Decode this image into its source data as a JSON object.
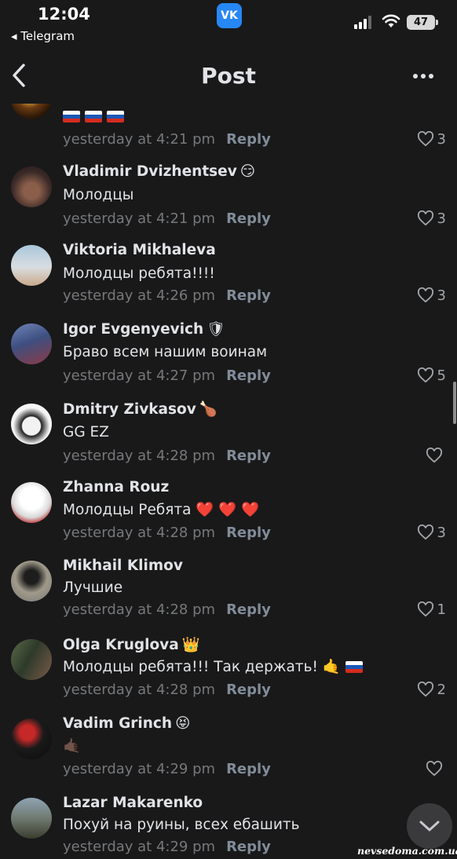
{
  "status_bar": {
    "time": "12:04",
    "back_app": "◂ Telegram",
    "app_icon_label": "VK",
    "battery": "47",
    "icons": [
      "signal-icon",
      "wifi-icon",
      "battery-icon"
    ]
  },
  "nav": {
    "title": "Post",
    "back_icon": "chevron-left-icon",
    "more_icon": "more-horizontal-icon"
  },
  "reply_label": "Reply",
  "comments": [
    {
      "name": "",
      "text": "",
      "flags": 3,
      "time": "yesterday at 4:21 pm",
      "likes": "3"
    },
    {
      "name": "Vladimir Dvizhentsev",
      "badge": "😏",
      "text": "Молодцы",
      "time": "yesterday at 4:21 pm",
      "likes": "3"
    },
    {
      "name": "Viktoria Mikhaleva",
      "badge": "",
      "text": "Молодцы ребята!!!!",
      "time": "yesterday at 4:26 pm",
      "likes": "3"
    },
    {
      "name": "Igor Evgenyevich",
      "badge": "🛡",
      "text": "Браво всем нашим воинам",
      "time": "yesterday at 4:27 pm",
      "likes": "5"
    },
    {
      "name": "Dmitry Zivkasov",
      "badge": "🍗",
      "text": "GG EZ",
      "time": "yesterday at 4:28 pm",
      "likes": ""
    },
    {
      "name": "Zhanna Rouz",
      "badge": "",
      "text": "Молодцы Ребята ❤️ ❤️ ❤️",
      "time": "yesterday at 4:28 pm",
      "likes": "3"
    },
    {
      "name": "Mikhail Klimov",
      "badge": "",
      "text": "Лучшие",
      "time": "yesterday at 4:28 pm",
      "likes": "1"
    },
    {
      "name": "Olga Kruglova",
      "badge": "👑",
      "text": "Молодцы ребята!!! Так держать! 🤙",
      "time": "yesterday at 4:28 pm",
      "likes": "2"
    },
    {
      "name": "Vadim Grinch",
      "badge": "😝",
      "text": "🤙🏿",
      "time": "yesterday at 4:29 pm",
      "likes": ""
    },
    {
      "name": "Lazar Makarenko",
      "badge": "",
      "text": "Похуй на руины, всех ебашить",
      "time": "yesterday at 4:29 pm",
      "likes": ""
    }
  ],
  "colors": {
    "background": "#19191a",
    "text_primary": "#e1e3e6",
    "text_secondary": "#76787a",
    "reply": "#818c99",
    "vk_blue": "#2787f5"
  },
  "watermark": "nevsedoma.com.ua"
}
